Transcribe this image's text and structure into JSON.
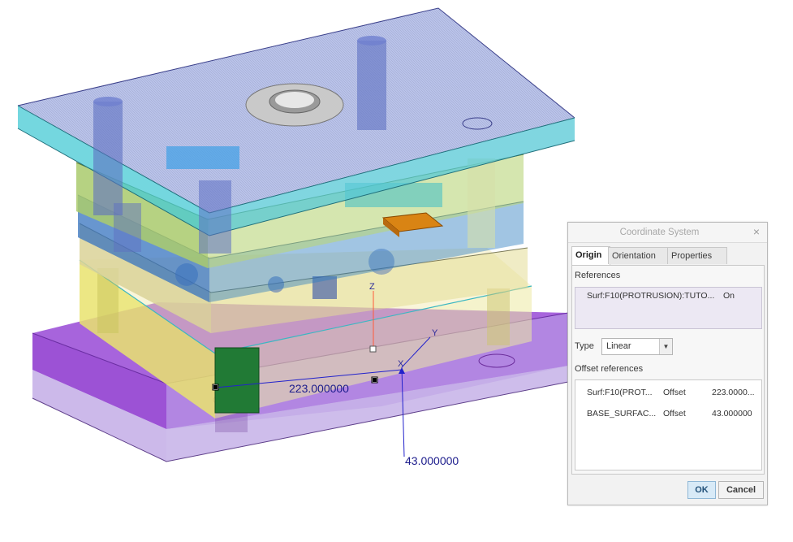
{
  "viewport": {
    "dimension_labels": {
      "offset_x": "223.000000",
      "offset_y": "43.000000"
    },
    "axis_labels": {
      "z": "Z",
      "x": "X",
      "y": "Y"
    }
  },
  "dialog": {
    "title": "Coordinate System",
    "close_glyph": "×",
    "tabs": [
      {
        "label": "Origin",
        "active": true
      },
      {
        "label": "Orientation",
        "active": false
      },
      {
        "label": "Properties",
        "active": false
      }
    ],
    "references": {
      "label": "References",
      "items": [
        {
          "name": "Surf:F10(PROTRUSION):TUTO...",
          "state": "On"
        }
      ]
    },
    "type": {
      "label": "Type",
      "value": "Linear"
    },
    "offset_references": {
      "label": "Offset references",
      "rows": [
        {
          "reference": "Surf:F10(PROT...",
          "kind": "Offset",
          "value": "223.0000..."
        },
        {
          "reference": "BASE_SURFAC...",
          "kind": "Offset",
          "value": "43.000000"
        }
      ]
    },
    "buttons": {
      "ok": "OK",
      "cancel": "Cancel"
    }
  },
  "colors": {
    "top_plate": "#7f8fd8",
    "top_plate_edge": "#46c9d4",
    "cavity_plate": "#b9d67a",
    "support_plate": "#e4dd95",
    "ejector_box": "#e9e36f",
    "base_plate": "#a057d9",
    "orange_insert": "#d98414",
    "green_block": "#217a35",
    "dimension_blue": "#1c1c8c"
  }
}
